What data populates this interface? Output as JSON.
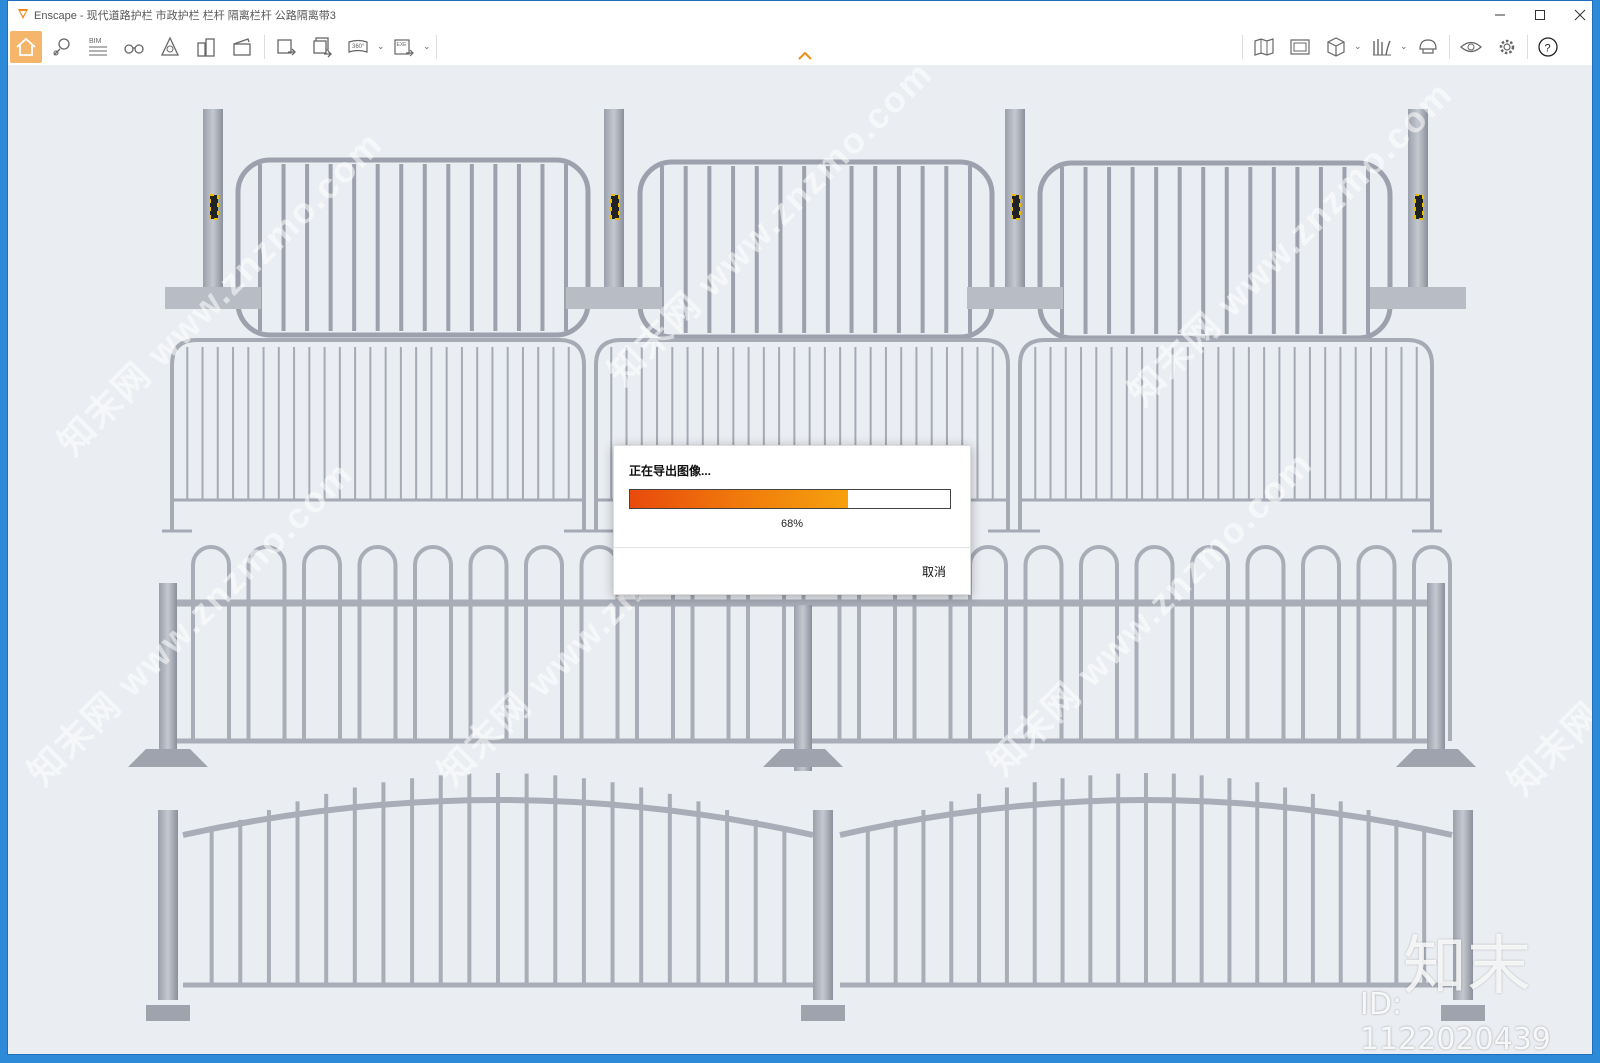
{
  "window": {
    "title": "Enscape - 现代道路护栏 市政护栏 栏杆 隔离栏杆 公路隔离带3"
  },
  "toolbar": {
    "left_icons": [
      "home-icon",
      "location-pin-icon",
      "bim-icon",
      "binoculars-icon",
      "assets-icon",
      "buildings-icon",
      "clapper-icon",
      "screenshot-export-icon",
      "batch-export-icon",
      "panorama-360-icon",
      "exe-export-icon"
    ],
    "bim_label": "BIM",
    "pano_label": "360°",
    "exe_label": "EXE",
    "right_icons": [
      "map-icon",
      "gallery-icon",
      "cube-icon",
      "bookshelf-icon",
      "helmet-icon",
      "eye-icon",
      "gear-icon",
      "help-icon"
    ],
    "accent_color": "#f5b66c"
  },
  "dialog": {
    "title": "正在导出图像...",
    "progress_percent": 68,
    "progress_label": "68%",
    "cancel_label": "取消"
  },
  "watermark": {
    "text": "知末网 www.znzmo.com",
    "logo_text": "知末",
    "id_text": "ID: 1122020439"
  }
}
